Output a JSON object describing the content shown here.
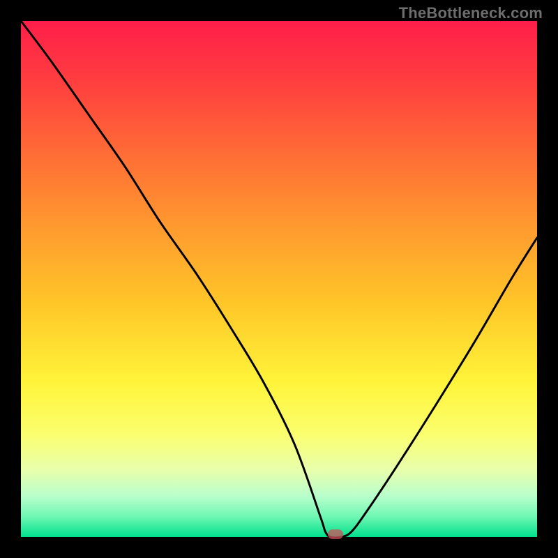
{
  "watermark": "TheBottleneck.com",
  "chart_data": {
    "type": "line",
    "title": "",
    "xlabel": "",
    "ylabel": "",
    "xlim": [
      0,
      100
    ],
    "ylim": [
      0,
      100
    ],
    "grid": false,
    "series": [
      {
        "name": "bottleneck-curve",
        "x": [
          0,
          6,
          13,
          20,
          27,
          34,
          41,
          47,
          53,
          58,
          59,
          60,
          62,
          64,
          67,
          73,
          80,
          88,
          95,
          100
        ],
        "y": [
          100,
          92,
          82,
          72,
          61,
          51,
          40,
          30,
          18,
          4,
          1,
          0,
          0,
          1,
          5,
          14,
          25,
          38,
          50,
          58
        ]
      }
    ],
    "marker": {
      "x": 61,
      "y": 0.5,
      "name": "optimal-point"
    }
  }
}
